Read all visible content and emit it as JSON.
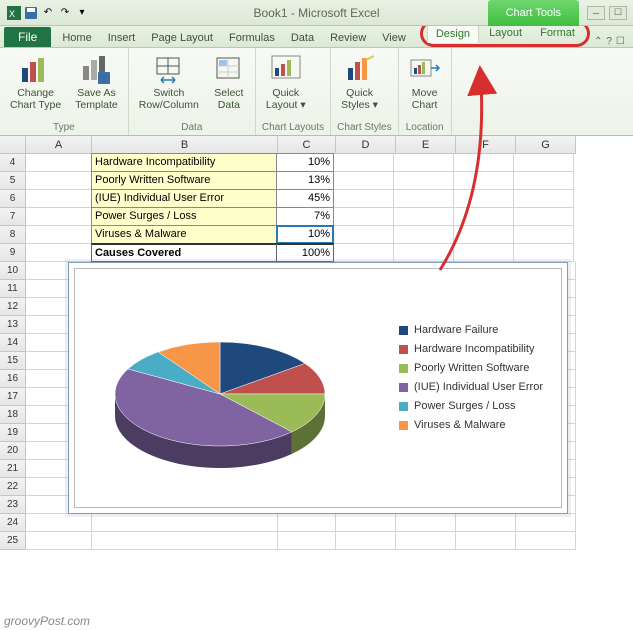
{
  "titlebar": {
    "title": "Book1 - Microsoft Excel",
    "chart_tools_label": "Chart Tools",
    "qat_icons": [
      "excel-icon",
      "save-icon",
      "undo-icon",
      "redo-icon",
      "dropdown-icon"
    ]
  },
  "ribbon_tabs": {
    "file": "File",
    "tabs": [
      "Home",
      "Insert",
      "Page Layout",
      "Formulas",
      "Data",
      "Review",
      "View"
    ],
    "chart_tool_tabs": [
      "Design",
      "Layout",
      "Format"
    ]
  },
  "ribbon_groups": [
    {
      "label": "Type",
      "buttons": [
        {
          "name": "change-chart-type",
          "label": "Change\nChart Type"
        },
        {
          "name": "save-as-template",
          "label": "Save As\nTemplate"
        }
      ]
    },
    {
      "label": "Data",
      "buttons": [
        {
          "name": "switch-row-column",
          "label": "Switch\nRow/Column"
        },
        {
          "name": "select-data",
          "label": "Select\nData"
        }
      ]
    },
    {
      "label": "Chart Layouts",
      "buttons": [
        {
          "name": "quick-layout",
          "label": "Quick\nLayout ▾"
        }
      ]
    },
    {
      "label": "Chart Styles",
      "buttons": [
        {
          "name": "quick-styles",
          "label": "Quick\nStyles ▾"
        }
      ]
    },
    {
      "label": "Location",
      "buttons": [
        {
          "name": "move-chart",
          "label": "Move\nChart"
        }
      ]
    }
  ],
  "columns": [
    "A",
    "B",
    "C",
    "D",
    "E",
    "F",
    "G"
  ],
  "rows_visible": [
    4,
    5,
    6,
    7,
    8,
    9,
    10,
    11,
    12,
    13,
    14,
    15,
    16,
    17,
    18,
    19,
    20,
    21,
    22,
    23,
    24,
    25
  ],
  "table": {
    "rows": [
      {
        "b": "Hardware Incompatibility",
        "c": "10%"
      },
      {
        "b": "Poorly Written Software",
        "c": "13%"
      },
      {
        "b": "(IUE) Individual User Error",
        "c": "45%"
      },
      {
        "b": "Power Surges / Loss",
        "c": "7%"
      },
      {
        "b": "Viruses & Malware",
        "c": "10%"
      }
    ],
    "total": {
      "b": "Causes Covered",
      "c": "100%"
    },
    "selected_cell": "C8"
  },
  "chart_data": {
    "type": "pie",
    "title": "",
    "series": [
      {
        "name": "Hardware Failure",
        "value": 15,
        "color": "#1f497d"
      },
      {
        "name": "Hardware Incompatibility",
        "value": 10,
        "color": "#c0504d"
      },
      {
        "name": "Poorly Written Software",
        "value": 13,
        "color": "#9bbb59"
      },
      {
        "name": "(IUE) Individual User Error",
        "value": 45,
        "color": "#8064a2"
      },
      {
        "name": "Power Surges / Loss",
        "value": 7,
        "color": "#4bacc6"
      },
      {
        "name": "Viruses & Malware",
        "value": 10,
        "color": "#f79646"
      }
    ]
  },
  "watermark": "groovyPost.com"
}
